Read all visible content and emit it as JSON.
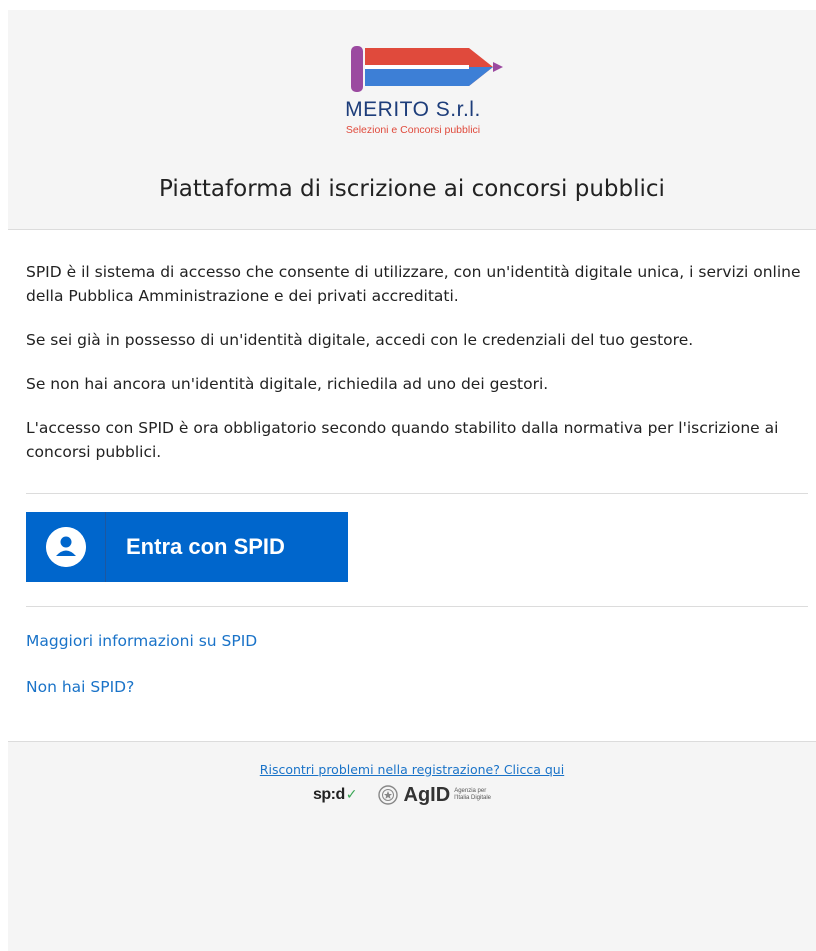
{
  "header": {
    "logo": {
      "title": "MERITO S.r.l.",
      "subtitle": "Selezioni e Concorsi pubblici",
      "colors": {
        "blue": "#1d3d7a",
        "red": "#e04a3c",
        "purple": "#9b4aa0",
        "pencil_blue": "#3d7fd6"
      }
    },
    "page_title": "Piattaforma di iscrizione ai concorsi pubblici"
  },
  "main": {
    "paragraphs": [
      "SPID è il sistema di accesso che consente di utilizzare, con un'identità digitale unica, i servizi online della Pubblica Amministrazione e dei privati accreditati.",
      "Se sei già in possesso di un'identità digitale, accedi con le credenziali del tuo gestore.",
      "Se non hai ancora un'identità digitale, richiedila ad uno dei gestori.",
      "L'accesso con SPID è ora obbligatorio secondo quando stabilito dalla normativa per l'iscrizione ai concorsi pubblici."
    ],
    "spid_button": {
      "label": "Entra con SPID",
      "icon": "user-icon",
      "color": "#0066cc"
    },
    "links": {
      "more_info": "Maggiori informazioni su SPID",
      "no_spid": "Non hai SPID?"
    }
  },
  "footer": {
    "help_link": "Riscontri problemi nella registrazione? Clicca qui",
    "spid_logo": "sp:d",
    "agid_logo": "AgID",
    "agid_caption_line1": "Agenzia per",
    "agid_caption_line2": "l'Italia Digitale"
  }
}
